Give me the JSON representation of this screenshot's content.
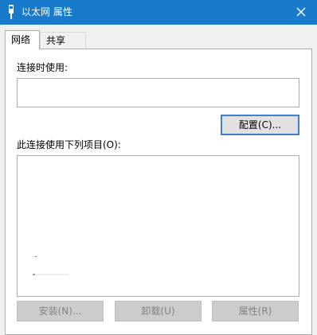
{
  "window": {
    "title": "以太网 属性"
  },
  "tabs": [
    {
      "label": "网络",
      "active": true
    },
    {
      "label": "共享",
      "active": false
    }
  ],
  "network": {
    "connect_using_label": "连接时使用:",
    "adapter_value": "",
    "configure_button": "配置(C)...",
    "items_label": "此连接使用下列项目(O):",
    "items": [],
    "install_button": "安装(N)...",
    "uninstall_button": "卸载(U)",
    "properties_button": "属性(R)"
  },
  "icons": {
    "title": "network-adapter-icon",
    "close": "close-icon"
  },
  "colors": {
    "titlebar": "#1979ca",
    "focus_border": "#3c7fce",
    "disabled_text": "#838383"
  }
}
